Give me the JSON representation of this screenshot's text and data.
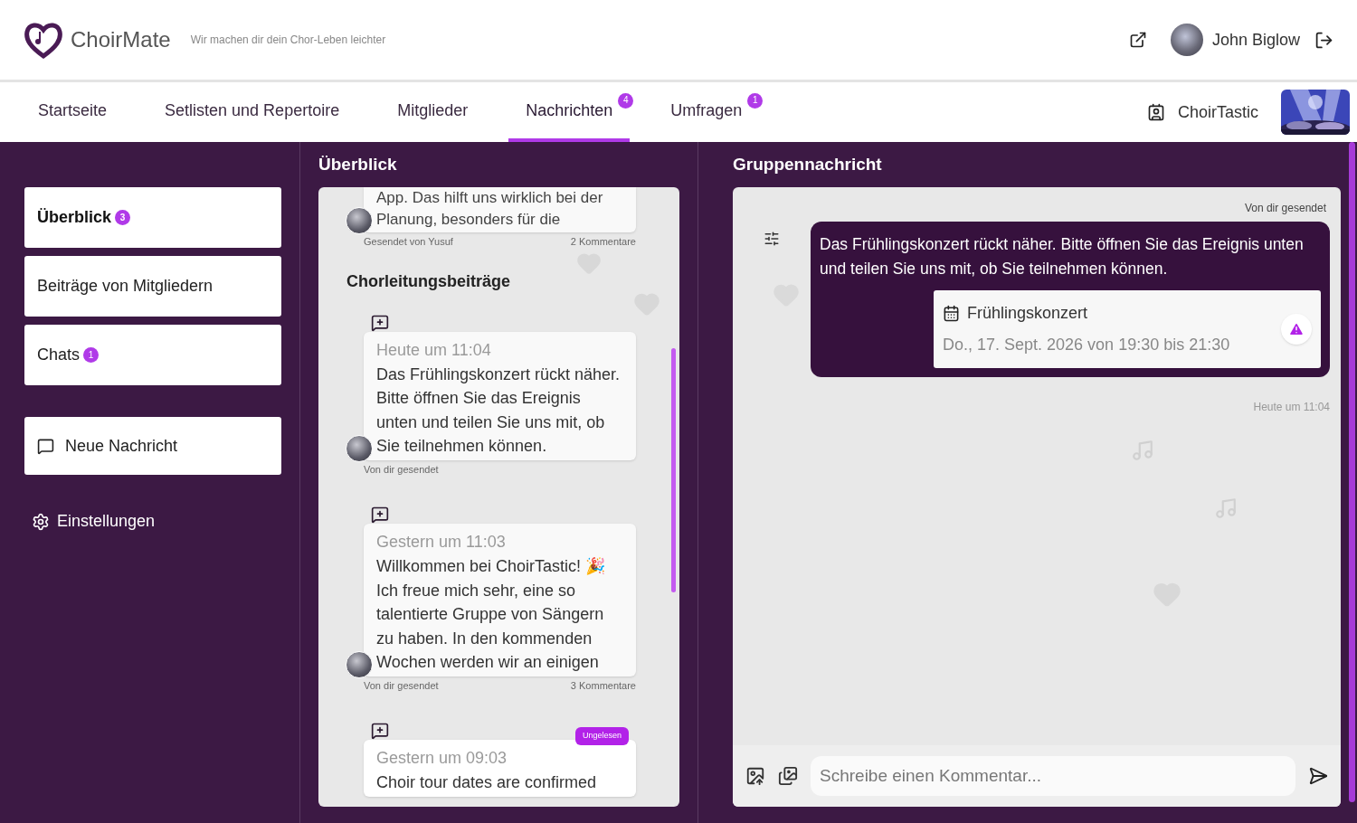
{
  "header": {
    "logo_text": "ChoirMate",
    "tagline": "Wir machen dir dein Chor-Leben leichter",
    "user_name": "John Biglow"
  },
  "nav": {
    "tabs": [
      {
        "label": "Startseite",
        "selected": false
      },
      {
        "label": "Setlisten und Repertoire",
        "selected": false
      },
      {
        "label": "Mitglieder",
        "selected": false
      },
      {
        "label": "Nachrichten",
        "selected": true,
        "badge": "4"
      },
      {
        "label": "Umfragen",
        "selected": false,
        "badge": "1"
      }
    ],
    "choir_name": "ChoirTastic"
  },
  "sidebar": {
    "items": [
      {
        "label": "Überblick",
        "selected": true,
        "badge": "3"
      },
      {
        "label": "Beiträge von Mitgliedern",
        "selected": false
      },
      {
        "label": "Chats",
        "selected": false,
        "badge": "1"
      }
    ],
    "new_message": "Neue Nachricht",
    "settings": "Einstellungen"
  },
  "overview": {
    "title": "Überblick",
    "partial_post": {
      "text": "App. Das hilft uns wirklich bei der Planung, besonders für die",
      "sender": "Gesendet von Yusuf",
      "comments": "2 Kommentare"
    },
    "section_title": "Chorleitungsbeiträge",
    "posts": [
      {
        "time": "Heute um 11:04",
        "text": "Das Frühlingskonzert rückt näher. Bitte öffnen Sie das Ereignis unten und teilen Sie uns mit, ob Sie teilnehmen können.",
        "sender": "Von dir gesendet",
        "unread": false
      },
      {
        "time": "Gestern um 11:03",
        "text": "Willkommen bei ChoirTastic! 🎉 Ich freue mich sehr, eine so talentierte Gruppe von Sängern zu haben. In den kommenden Wochen werden wir an einigen",
        "sender": "Von dir gesendet",
        "comments": "3 Kommentare",
        "unread": false
      },
      {
        "time": "Gestern um 09:03",
        "text": "Choir tour dates are confirmed",
        "unread": true,
        "unread_label": "Ungelesen"
      }
    ]
  },
  "group_message": {
    "title": "Gruppennachricht",
    "sender_label": "Von dir gesendet",
    "text": "Das Frühlingskonzert rückt näher. Bitte öffnen Sie das Ereignis unten und teilen Sie uns mit, ob Sie teilnehmen können.",
    "event": {
      "title": "Frühlingskonzert",
      "date": "Do., 17. Sept. 2026 von 19:30 bis 21:30"
    },
    "time": "Heute um 11:04",
    "comment_placeholder": "Schreibe einen Kommentar..."
  }
}
